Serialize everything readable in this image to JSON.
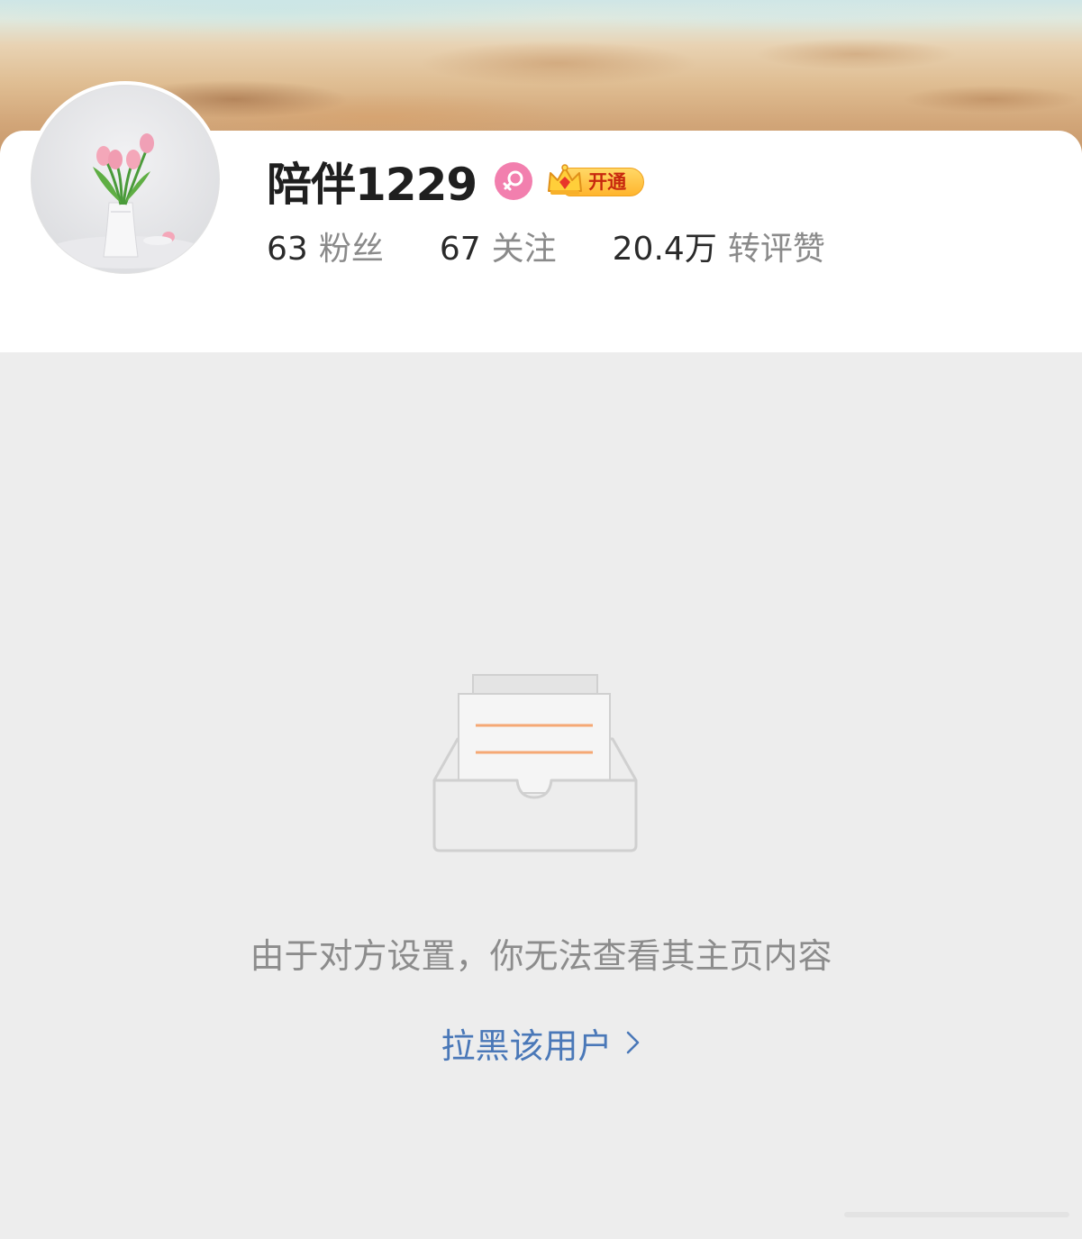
{
  "profile": {
    "username": "陪伴1229",
    "gender": "female-icon",
    "vip_badge_label": "开通",
    "stats": [
      {
        "value": "63",
        "label": "粉丝"
      },
      {
        "value": "67",
        "label": "关注"
      },
      {
        "value": "20.4万",
        "label": "转评赞"
      }
    ]
  },
  "empty_state": {
    "icon": "empty-inbox-icon",
    "message": "由于对方设置，你无法查看其主页内容",
    "block_link_label": "拉黑该用户"
  },
  "colors": {
    "link": "#4a78b8",
    "gender_badge": "#f27fae",
    "vip_gold": "#ffb52e",
    "background": "#ededed"
  }
}
